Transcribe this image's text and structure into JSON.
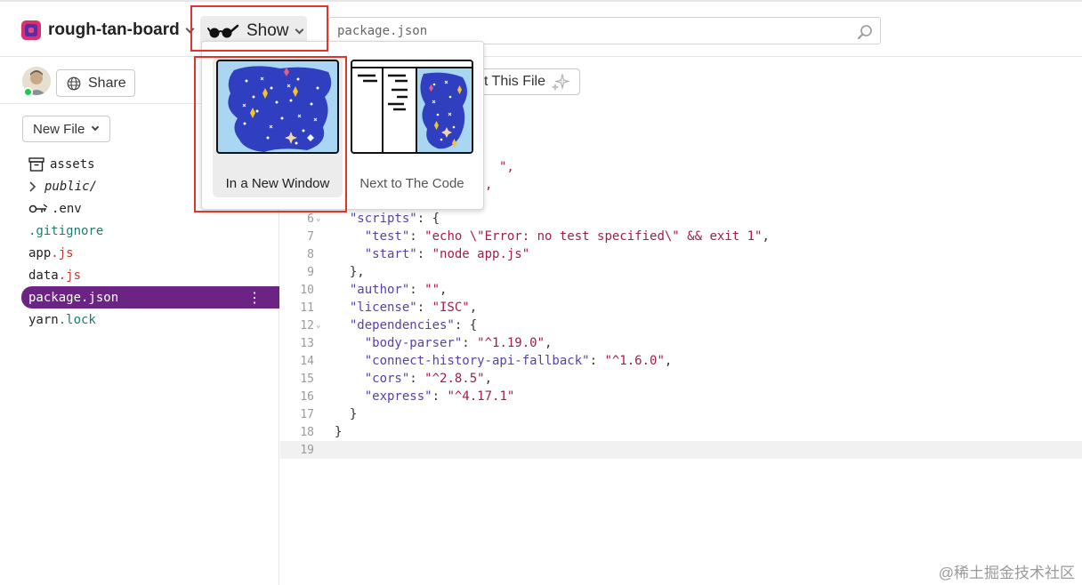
{
  "project": {
    "name": "rough-tan-board"
  },
  "show": {
    "label": "Show",
    "options": [
      {
        "label": "In a New Window"
      },
      {
        "label": "Next to The Code"
      }
    ]
  },
  "search": {
    "placeholder": "package.json"
  },
  "sidebar": {
    "share_label": "Share",
    "new_file_label": "New File",
    "files": [
      {
        "name": "assets",
        "icon": "archive-icon"
      },
      {
        "name": "public/",
        "icon": "chevron-right-icon"
      },
      {
        "name": ".env",
        "icon": "key-icon"
      },
      {
        "name": ".gitignore"
      },
      {
        "name": "app",
        "ext": ".js"
      },
      {
        "name": "data",
        "ext": ".js"
      },
      {
        "name": "package.json",
        "selected": true
      },
      {
        "name": "yarn",
        "ext": ".lock"
      }
    ]
  },
  "editor": {
    "remix_label": "t This File",
    "partial_lines": [
      "\",",
      ","
    ],
    "lines": [
      {
        "n": "6",
        "fold": true,
        "code": "  \"scripts\": {"
      },
      {
        "n": "7",
        "code": "    \"test\": \"echo \\\"Error: no test specified\\\" && exit 1\","
      },
      {
        "n": "8",
        "code": "    \"start\": \"node app.js\""
      },
      {
        "n": "9",
        "code": "  },"
      },
      {
        "n": "10",
        "code": "  \"author\": \"\","
      },
      {
        "n": "11",
        "code": "  \"license\": \"ISC\","
      },
      {
        "n": "12",
        "fold": true,
        "code": "  \"dependencies\": {"
      },
      {
        "n": "13",
        "code": "    \"body-parser\": \"^1.19.0\","
      },
      {
        "n": "14",
        "code": "    \"connect-history-api-fallback\": \"^1.6.0\","
      },
      {
        "n": "15",
        "code": "    \"cors\": \"^2.8.5\","
      },
      {
        "n": "16",
        "code": "    \"express\": \"^4.17.1\""
      },
      {
        "n": "17",
        "code": "  }"
      },
      {
        "n": "18",
        "code": "}"
      },
      {
        "n": "19",
        "code": "",
        "active": true
      }
    ]
  },
  "watermark": "@稀土掘金技术社区",
  "colors": {
    "selected_file": "#6b2384",
    "highlight_box": "#e0352b",
    "string": "#9e1d4d",
    "key": "#5b3fa6"
  }
}
